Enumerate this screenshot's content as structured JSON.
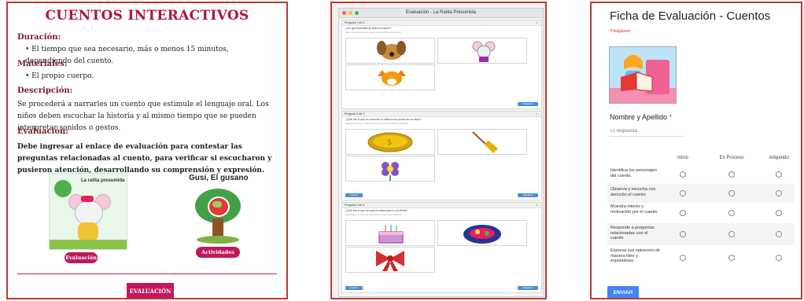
{
  "panel1": {
    "title": "CUENTOS INTERACTIVOS",
    "duracion_heading": "Duración:",
    "duracion_text": "El tiempo que sea necesario, más o menos 15 minutos, dependiendo del cuento.",
    "materiales_heading": "Materiales:",
    "materiales_text": "El propio cuerpo.",
    "descripcion_heading": "Descripción:",
    "descripcion_text": "Se procederá a narrarles un cuento que estimule el lenguaje oral. Los niños deben escuchar la historia y al mismo tiempo que se pueden interpretar sonidos o gestos.",
    "evaluacion_heading": "Evaluación:",
    "evaluacion_text": "Debe ingresar al enlace de evaluación para contestar las preguntas relacionadas al cuento, para verificar si escucharon y pusieron atención, desarrollando su comprensión y expresión.",
    "book_title": "La ratita presumida",
    "gusi_title": "Gusi, El gusano",
    "evaluacion_button": "Evaluación",
    "actividades_button": "Actividades",
    "main_button": "EVALUACIÓN"
  },
  "panel2": {
    "window_title": "Evaluación - La Ratita Presumida",
    "questions": [
      {
        "header": "Pregunta 1 de 3",
        "text": "¿De qué animalito se trata el cuento?",
        "sub": "Seleccione una de las siguientes respuestas posibles",
        "next": "Siguiente"
      },
      {
        "header": "Pregunta 2 de 3",
        "text": "¿Qué fue lo que se encontró la ratita en la puerta de su casa?",
        "sub": "Seleccione una o más de las siguientes respuestas posibles",
        "prev": "Anterior",
        "next": "Siguiente"
      },
      {
        "header": "Pregunta 3 de 3",
        "text": "¿Qué fue lo que se puso la ratita para ir a la fiesta?",
        "sub": "Seleccione una de las siguientes respuestas posibles",
        "prev": "Anterior",
        "next": "Siguiente"
      }
    ]
  },
  "panel3": {
    "title": "Ficha de Evaluación - Cuentos",
    "required_note": "*Obligatorio",
    "name_label": "Nombre y Apellido",
    "name_required_mark": "*",
    "name_placeholder": "Tu respuesta",
    "columns": [
      "Inicio",
      "En Proceso",
      "Adquirido"
    ],
    "rows": [
      "Identifica los personajes del cuento.",
      "Observa y escucha con atención el cuento",
      "Muestra interés y motivación por el cuento",
      "Responde a preguntas relacionadas con el cuento",
      "Expresa sus opiniones de manera libre y espontánea."
    ],
    "send_button": "ENVIAR"
  },
  "colors": {
    "frame": "#c0392b",
    "magenta": "#c2185b",
    "form_blue": "#4285f4"
  }
}
